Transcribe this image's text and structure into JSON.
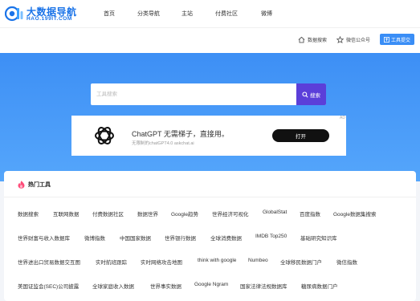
{
  "logo": {
    "title": "大数据导航",
    "domain": "HAO.199IT.COM"
  },
  "nav": [
    {
      "label": "首页"
    },
    {
      "label": "分类导航"
    },
    {
      "label": "主站"
    },
    {
      "label": "付费社区"
    },
    {
      "label": "微博"
    }
  ],
  "subbar": {
    "data_search": "数据搜索",
    "wechat": "微信公众号",
    "tools": "工具提交"
  },
  "search": {
    "placeholder": "工具搜索",
    "button": "搜索"
  },
  "ad": {
    "mark": "AD",
    "title": "ChatGPT 无需梯子，直接用。",
    "subtitle": "无限制的chatGPT4.0 askchat.ai",
    "button": "打开"
  },
  "panel": {
    "title": "热门工具",
    "rows": [
      [
        "数据搜索",
        "互联网数据",
        "付费数据社区",
        "数据世界",
        "Google趋势",
        "世界经济可视化",
        "GlobalStat",
        "百度指数",
        "Google数据集搜索"
      ],
      [
        "世界财富与收入数据库",
        "微博指数",
        "中国国家数据",
        "世界银行数据",
        "全球消费数据",
        "IMDB Top250",
        "基础研究知识库"
      ],
      [
        "世界进出口贸易数据交互图",
        "实时航班跟踪",
        "实时网络攻击地图",
        "think with google",
        "Numbeo",
        "全球移民数据门户",
        "微信指数"
      ],
      [
        "美国证监会(SEC)公司披露",
        "全球家庭收入数据",
        "世界事实数据",
        "Google Ngram",
        "国家法律法规数据库",
        "糖尿病数据门户"
      ]
    ]
  },
  "colors": {
    "hero_top": "#3d8ff5",
    "accent": "#1a73e8",
    "search_button": "#5b3fd9",
    "tool_button": "#3a8ef6"
  }
}
